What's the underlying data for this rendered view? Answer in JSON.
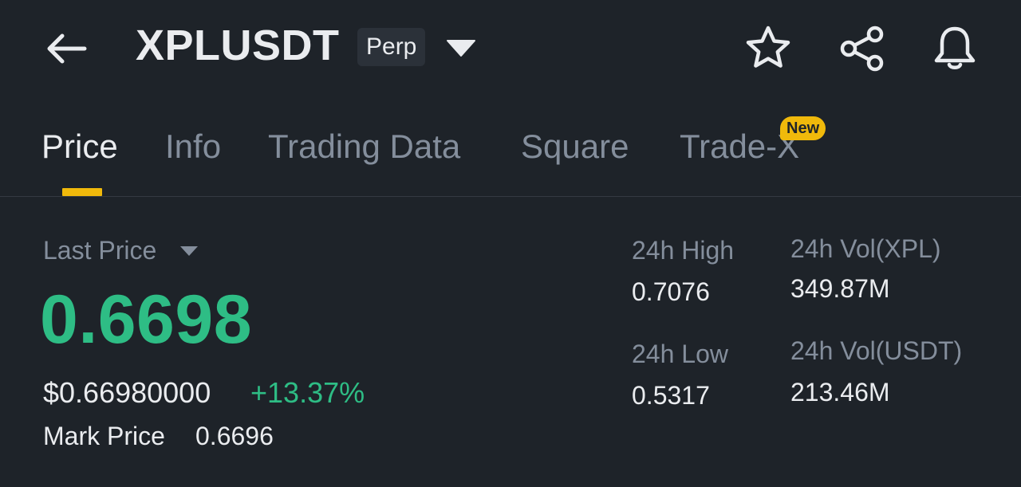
{
  "header": {
    "symbol": "XPLUSDT",
    "badge": "Perp",
    "icons": {
      "back": "arrow-left-icon",
      "dropdown": "caret-down-icon",
      "favorite": "star-icon",
      "share": "share-icon",
      "alert": "bell-icon"
    }
  },
  "tabs": {
    "items": [
      {
        "label": "Price",
        "active": true
      },
      {
        "label": "Info",
        "active": false
      },
      {
        "label": "Trading Data",
        "active": false
      },
      {
        "label": "Square",
        "active": false
      },
      {
        "label": "Trade-X",
        "active": false
      }
    ],
    "new_badge": "New"
  },
  "price": {
    "last_price_label": "Last Price",
    "last_price": "0.6698",
    "usd_price": "$0.66980000",
    "change_pct": "+13.37%",
    "mark_price_label": "Mark Price",
    "mark_price": "0.6696"
  },
  "stats": {
    "high_label": "24h High",
    "high_value": "0.7076",
    "low_label": "24h Low",
    "low_value": "0.5317",
    "vol_xpl_label": "24h Vol(XPL)",
    "vol_xpl_value": "349.87M",
    "vol_usdt_label": "24h Vol(USDT)",
    "vol_usdt_value": "213.46M"
  },
  "colors": {
    "background": "#1e2329",
    "up_green": "#2ebd85",
    "accent_yellow": "#f0b90b",
    "text_primary": "#eaecef",
    "text_secondary": "#848e9c"
  }
}
